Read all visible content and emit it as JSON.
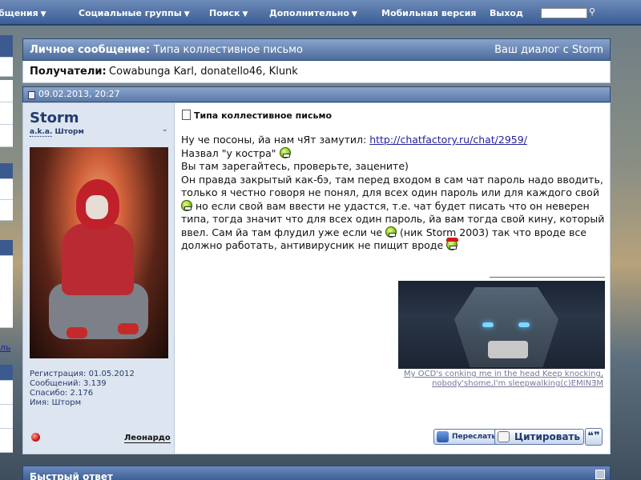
{
  "nav": {
    "items": [
      {
        "label": "бщения",
        "caret": true
      },
      {
        "label": "Социальные группы",
        "caret": true
      },
      {
        "label": "Поиск",
        "caret": true
      },
      {
        "label": "Дополнительно",
        "caret": true
      },
      {
        "label": "Мобильная версия",
        "caret": false
      },
      {
        "label": "Выход",
        "caret": false
      }
    ],
    "search_value": ""
  },
  "left": {
    "link_text": "ль"
  },
  "pm": {
    "header_label": "Личное сообщение",
    "header_sep": ": ",
    "header_subject": "Типа коллестивное письмо",
    "dialog_link": "Ваш диалог с Storm",
    "recipients_label": "Получатели",
    "recipients_sep": ": ",
    "recipients_value": "Cowabunga Karl, donatello46, Klunk",
    "date": "09.02.2013, 20:27"
  },
  "user": {
    "name": "Storm",
    "aka": "a.k.a.",
    "alias": "Шторм",
    "info": [
      "Регистрация: 01.05.2012",
      "Сообщений: 3.139",
      "Спасибо: 2.176",
      "Имя: Шторм"
    ],
    "reputation_name": "Леонардо"
  },
  "message": {
    "title": "Типа коллестивное письмо",
    "line1_prefix": "Ну че посоны, йа нам чЯт замутил: ",
    "line1_link": "http://chatfactory.ru/chat/2959/",
    "line2": "Назвал \"у костра\" ",
    "line3": "Вы там зарегайтесь, проверьте, зацените)",
    "line4_part1": "Он правда закрытый как-бэ, там перед входом в сам чат пароль надо вводить, только я честно говоря не понял, для всех один пароль или для каждого свой ",
    "line4_part2": " но если свой вам ввести не удастся, т.е. чат будет писать что он неверен типа, тогда значит что для всех один пароль, йа вам тогда свой кину, который ввел. Сам йа там флудил уже если че ",
    "line4_part3": " (ник Storm 2003) так что вроде все должно работать, антивирусник не пищит вроде ",
    "signature_caption": "My OCD's conking me in the head Keep knocking, nobody'shome,I'm sleepwalking(c)EMINƎM"
  },
  "buttons": {
    "forward": "Переслать",
    "quote": "Цитировать",
    "multi_quote": "❝❞"
  },
  "quick_reply": {
    "title": "Быстрый ответ"
  }
}
